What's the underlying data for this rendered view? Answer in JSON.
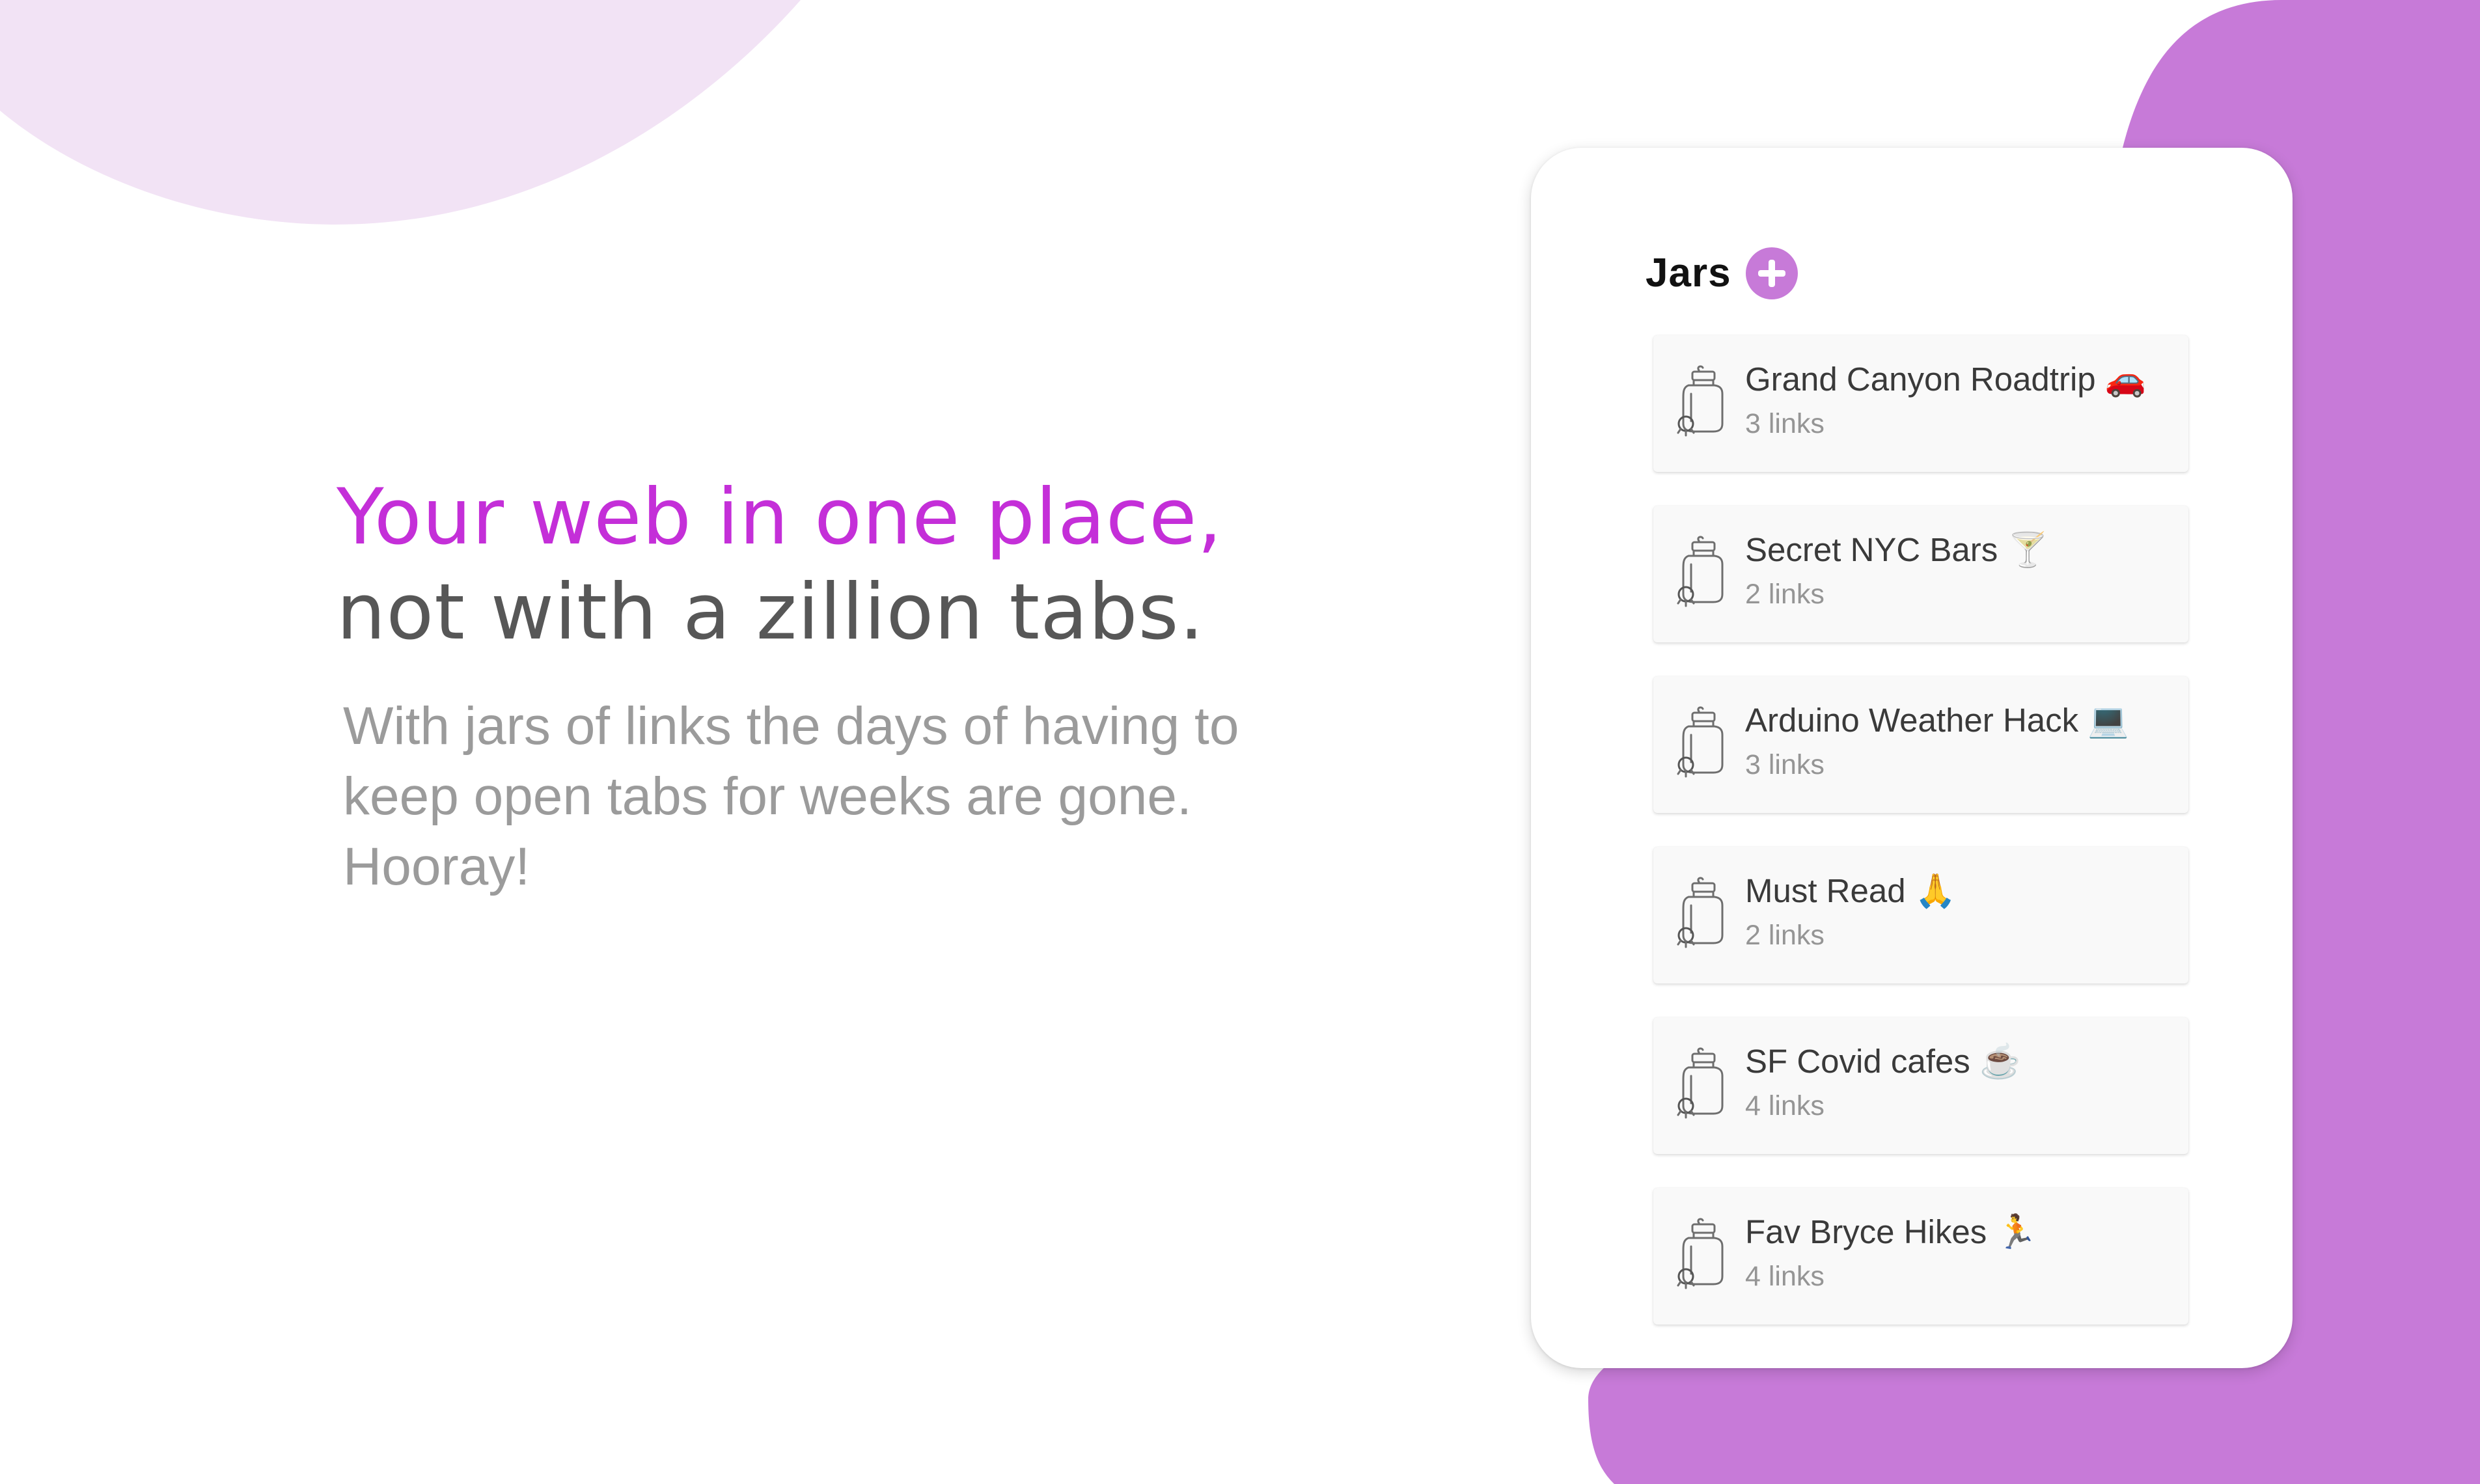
{
  "colors": {
    "accent": "#c42fd8",
    "headline_secondary": "#575757",
    "subtext": "#9b9b9b",
    "blob_light": "#f2e3f5",
    "blob_strong": "#c77ad8",
    "add_button": "#c77ad8"
  },
  "hero": {
    "headline_accent": "Your web in one place,",
    "headline_rest": "not with a zillion tabs.",
    "subtext": "With jars of links the days of having to keep open tabs for weeks are gone. Hooray!"
  },
  "panel": {
    "title": "Jars",
    "add_icon": "plus-circle-icon",
    "jar_icon": "jar-icon",
    "jars": [
      {
        "name": "Grand Canyon Roadtrip 🚗",
        "count": "3 links"
      },
      {
        "name": "Secret NYC Bars 🍸",
        "count": "2 links"
      },
      {
        "name": "Arduino Weather Hack 💻",
        "count": "3 links"
      },
      {
        "name": "Must Read 🙏",
        "count": "2 links"
      },
      {
        "name": "SF Covid cafes ☕",
        "count": "4 links"
      },
      {
        "name": "Fav Bryce Hikes 🏃",
        "count": "4 links"
      }
    ]
  }
}
